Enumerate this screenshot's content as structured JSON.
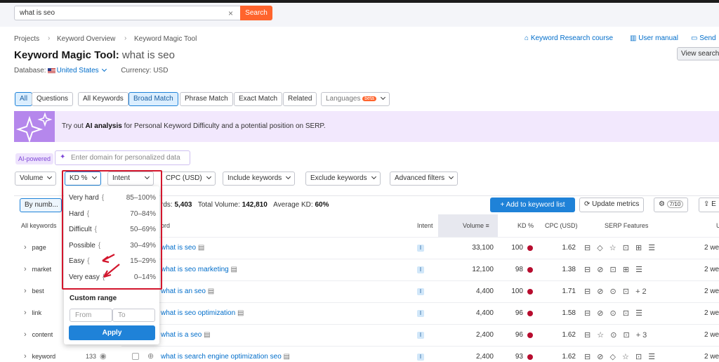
{
  "search": {
    "value": "what is seo",
    "button": "Search"
  },
  "breadcrumb": [
    "Projects",
    "Keyword Overview",
    "Keyword Magic Tool"
  ],
  "header": {
    "title": "Keyword Magic Tool:",
    "query": "what is seo",
    "database_label": "Database:",
    "database_value": "United States",
    "currency_label": "Currency: USD"
  },
  "top_links": {
    "course": "Keyword Research course",
    "manual": "User manual",
    "send": "Send",
    "view_search": "View search"
  },
  "tabs": {
    "all": "All",
    "questions": "Questions",
    "all_keywords": "All Keywords",
    "broad": "Broad Match",
    "phrase": "Phrase Match",
    "exact": "Exact Match",
    "related": "Related",
    "languages": "Languages",
    "beta": "beta"
  },
  "ai": {
    "text_pre": "Try out ",
    "text_bold": "AI analysis",
    "text_post": " for Personal Keyword Difficulty and a potential position on SERP.",
    "powered": "AI-powered",
    "domain_placeholder": "Enter domain for personalized data"
  },
  "filters": {
    "volume": "Volume",
    "kd": "KD %",
    "intent": "Intent",
    "cpc": "CPC (USD)",
    "include": "Include keywords",
    "exclude": "Exclude keywords",
    "advanced": "Advanced filters"
  },
  "kd_dropdown": {
    "options": [
      {
        "label": "Very hard",
        "range": "85–100%"
      },
      {
        "label": "Hard",
        "range": "70–84%"
      },
      {
        "label": "Difficult",
        "range": "50–69%"
      },
      {
        "label": "Possible",
        "range": "30–49%"
      },
      {
        "label": "Easy",
        "range": "15–29%"
      },
      {
        "label": "Very easy",
        "range": "0–14%"
      }
    ],
    "custom_range": "Custom range",
    "from": "From",
    "to": "To",
    "apply": "Apply"
  },
  "summary": {
    "by_number": "By numb...",
    "keywords_label": "rds:",
    "keywords_value": "5,403",
    "volume_label": "Total Volume:",
    "volume_value": "142,810",
    "kd_label": "Average KD:",
    "kd_value": "60%"
  },
  "actions": {
    "add_to_list": "Add to keyword list",
    "update_metrics": "Update metrics",
    "settings_count": "7/10",
    "export": "E"
  },
  "sidebar": {
    "title": "All keywords",
    "items": [
      "page",
      "market",
      "best",
      "link",
      "content",
      "keyword"
    ],
    "keyword_count": "133"
  },
  "columns": {
    "keyword": "ord",
    "intent": "Intent",
    "volume": "Volume",
    "kd": "KD %",
    "cpc": "CPC (USD)",
    "serp": "SERP Features",
    "updated": "U"
  },
  "rows": [
    {
      "keyword": "what is seo",
      "intent": "I",
      "volume": "33,100",
      "kd": "100",
      "cpc": "1.62",
      "serp": "⊟ ◇ ☆ ⊡ ⊞ ☰",
      "updated": "2 we"
    },
    {
      "keyword": "what is seo marketing",
      "intent": "I",
      "volume": "12,100",
      "kd": "98",
      "cpc": "1.38",
      "serp": "⊟ ⊘ ⊡ ⊞ ☰",
      "updated": "2 we"
    },
    {
      "keyword": "what is an seo",
      "intent": "I",
      "volume": "4,400",
      "kd": "100",
      "cpc": "1.71",
      "serp": "⊟ ⊘ ⊙ ⊡ +2",
      "updated": "2 we"
    },
    {
      "keyword": "what is seo optimization",
      "intent": "I",
      "volume": "4,400",
      "kd": "96",
      "cpc": "1.58",
      "serp": "⊟ ⊘ ⊙ ⊡ ☰",
      "updated": "2 we"
    },
    {
      "keyword": "what is a seo",
      "intent": "I",
      "volume": "2,400",
      "kd": "96",
      "cpc": "1.62",
      "serp": "⊟ ☆ ⊙ ⊡ +3",
      "updated": "2 we"
    },
    {
      "keyword": "what is search engine optimization seo",
      "intent": "I",
      "volume": "2,400",
      "kd": "93",
      "cpc": "1.62",
      "serp": "⊟ ⊘ ◇ ☆ ⊡ ☰",
      "updated": "2 we"
    }
  ],
  "colors": {
    "accent": "#1f82d8",
    "search": "#ff642d",
    "kd_dot": "#b70c2e",
    "highlight": "#d3162d",
    "ai_purple": "#b587ec"
  }
}
